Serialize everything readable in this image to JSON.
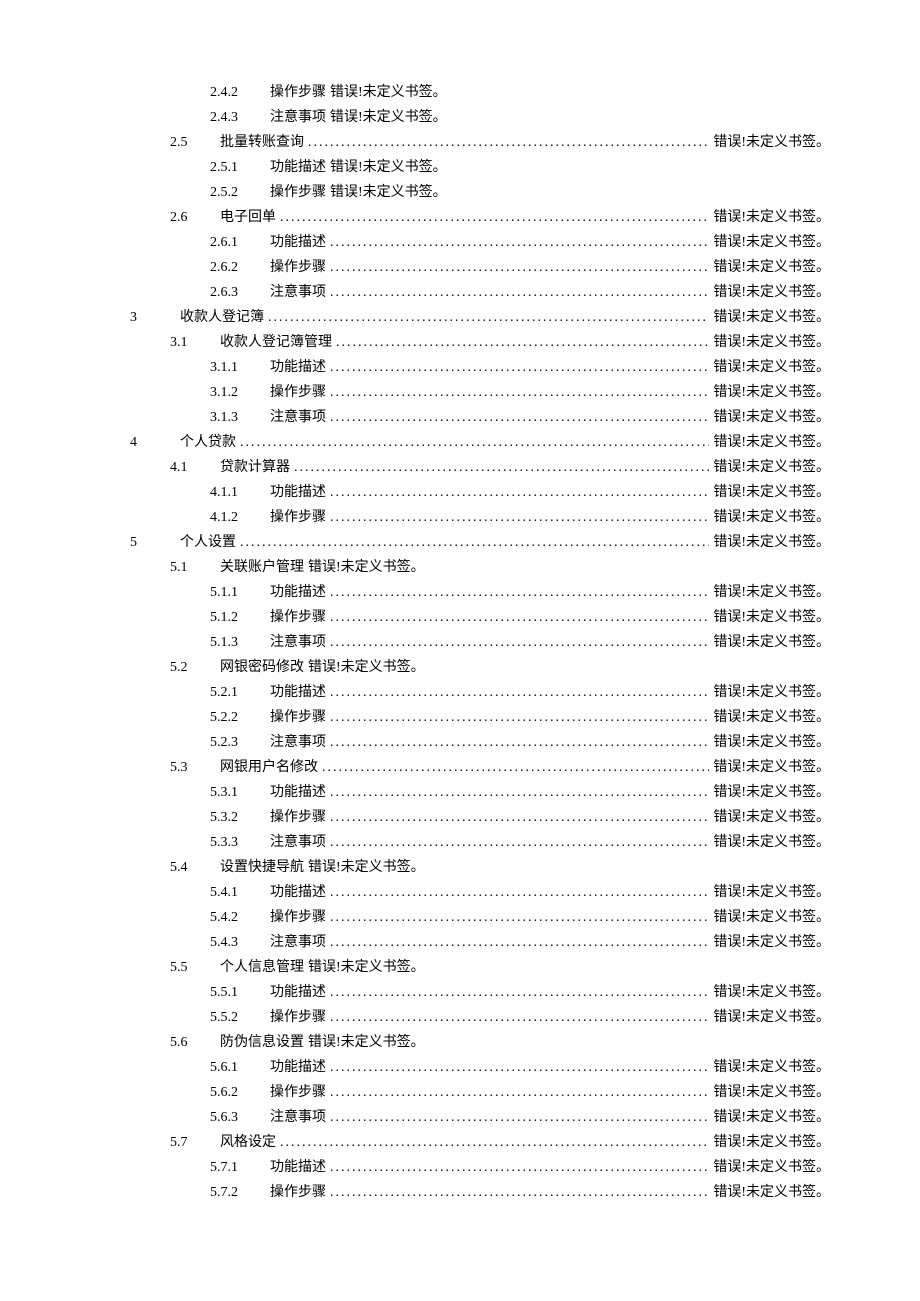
{
  "err": "错误!未定义书签。",
  "entries": [
    {
      "lvl": 3,
      "num": "2.4.2",
      "title": "操作步骤",
      "inline": true
    },
    {
      "lvl": 3,
      "num": "2.4.3",
      "title": "注意事项",
      "inline": true
    },
    {
      "lvl": 2,
      "num": "2.5",
      "title": "批量转账查询",
      "inline": false
    },
    {
      "lvl": 3,
      "num": "2.5.1",
      "title": "功能描述",
      "inline": true
    },
    {
      "lvl": 3,
      "num": "2.5.2",
      "title": "操作步骤",
      "inline": true
    },
    {
      "lvl": 2,
      "num": "2.6",
      "title": "电子回单",
      "inline": false
    },
    {
      "lvl": 3,
      "num": "2.6.1",
      "title": "功能描述",
      "inline": false
    },
    {
      "lvl": 3,
      "num": "2.6.2",
      "title": "操作步骤",
      "inline": false
    },
    {
      "lvl": 3,
      "num": "2.6.3",
      "title": "注意事项",
      "inline": false
    },
    {
      "lvl": 1,
      "num": "3",
      "title": "收款人登记簿",
      "inline": false
    },
    {
      "lvl": 2,
      "num": "3.1",
      "title": "收款人登记簿管理",
      "inline": false
    },
    {
      "lvl": 3,
      "num": "3.1.1",
      "title": "功能描述",
      "inline": false
    },
    {
      "lvl": 3,
      "num": "3.1.2",
      "title": "操作步骤",
      "inline": false
    },
    {
      "lvl": 3,
      "num": "3.1.3",
      "title": "注意事项",
      "inline": false
    },
    {
      "lvl": 1,
      "num": "4",
      "title": "个人贷款",
      "inline": false
    },
    {
      "lvl": 2,
      "num": "4.1",
      "title": "贷款计算器",
      "inline": false
    },
    {
      "lvl": 3,
      "num": "4.1.1",
      "title": "功能描述",
      "inline": false
    },
    {
      "lvl": 3,
      "num": "4.1.2",
      "title": "操作步骤",
      "inline": false
    },
    {
      "lvl": 1,
      "num": "5",
      "title": "个人设置",
      "inline": false
    },
    {
      "lvl": 2,
      "num": "5.1",
      "title": "关联账户管理",
      "inline": true
    },
    {
      "lvl": 3,
      "num": "5.1.1",
      "title": "功能描述",
      "inline": false
    },
    {
      "lvl": 3,
      "num": "5.1.2",
      "title": "操作步骤",
      "inline": false
    },
    {
      "lvl": 3,
      "num": "5.1.3",
      "title": "注意事项",
      "inline": false
    },
    {
      "lvl": 2,
      "num": "5.2",
      "title": "网银密码修改",
      "inline": true
    },
    {
      "lvl": 3,
      "num": "5.2.1",
      "title": "功能描述",
      "inline": false
    },
    {
      "lvl": 3,
      "num": "5.2.2",
      "title": "操作步骤",
      "inline": false
    },
    {
      "lvl": 3,
      "num": "5.2.3",
      "title": "注意事项",
      "inline": false
    },
    {
      "lvl": 2,
      "num": "5.3",
      "title": "网银用户名修改",
      "inline": false
    },
    {
      "lvl": 3,
      "num": "5.3.1",
      "title": "功能描述",
      "inline": false
    },
    {
      "lvl": 3,
      "num": "5.3.2",
      "title": "操作步骤",
      "inline": false
    },
    {
      "lvl": 3,
      "num": "5.3.3",
      "title": "注意事项",
      "inline": false
    },
    {
      "lvl": 2,
      "num": "5.4",
      "title": "设置快捷导航",
      "inline": true
    },
    {
      "lvl": 3,
      "num": "5.4.1",
      "title": "功能描述",
      "inline": false
    },
    {
      "lvl": 3,
      "num": "5.4.2",
      "title": "操作步骤",
      "inline": false
    },
    {
      "lvl": 3,
      "num": "5.4.3",
      "title": "注意事项",
      "inline": false
    },
    {
      "lvl": 2,
      "num": "5.5",
      "title": "个人信息管理",
      "inline": true
    },
    {
      "lvl": 3,
      "num": "5.5.1",
      "title": "功能描述",
      "inline": false
    },
    {
      "lvl": 3,
      "num": "5.5.2",
      "title": "操作步骤",
      "inline": false
    },
    {
      "lvl": 2,
      "num": "5.6",
      "title": "防伪信息设置",
      "inline": true
    },
    {
      "lvl": 3,
      "num": "5.6.1",
      "title": "功能描述",
      "inline": false
    },
    {
      "lvl": 3,
      "num": "5.6.2",
      "title": "操作步骤",
      "inline": false
    },
    {
      "lvl": 3,
      "num": "5.6.3",
      "title": "注意事项",
      "inline": false
    },
    {
      "lvl": 2,
      "num": "5.7",
      "title": "风格设定",
      "inline": false
    },
    {
      "lvl": 3,
      "num": "5.7.1",
      "title": "功能描述",
      "inline": false
    },
    {
      "lvl": 3,
      "num": "5.7.2",
      "title": "操作步骤",
      "inline": false
    }
  ]
}
